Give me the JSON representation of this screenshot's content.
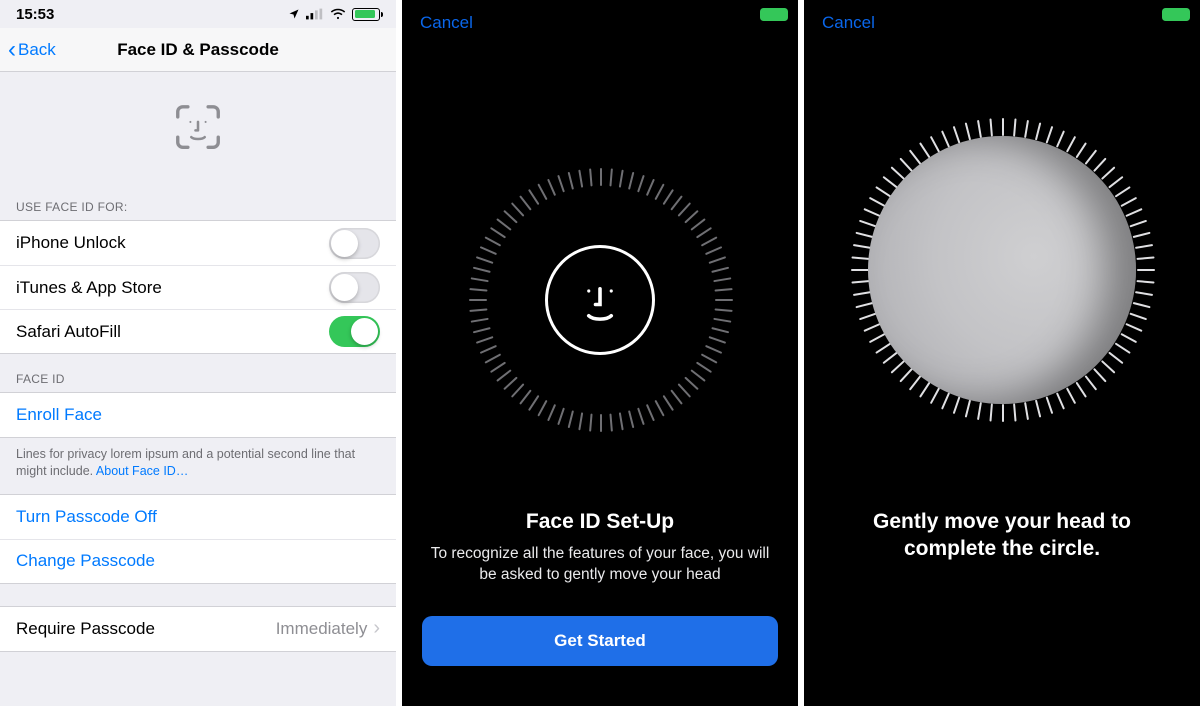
{
  "screen1": {
    "status_time": "15:53",
    "nav": {
      "back": "Back",
      "title": "Face ID & Passcode"
    },
    "section_use_header": "USE FACE ID FOR:",
    "toggles": [
      {
        "label": "iPhone Unlock",
        "on": false
      },
      {
        "label": "iTunes & App Store",
        "on": false
      },
      {
        "label": "Safari AutoFill",
        "on": true
      }
    ],
    "section_faceid_header": "FACE ID",
    "enroll_label": "Enroll Face",
    "privacy_note": "Lines for privacy lorem ipsum and a potential second line that might include. ",
    "privacy_link": "About Face ID…",
    "turn_off_label": "Turn Passcode Off",
    "change_label": "Change Passcode",
    "require_label": "Require Passcode",
    "require_value": "Immediately"
  },
  "screen2": {
    "cancel": "Cancel",
    "headline": "Face ID Set-Up",
    "sub": "To recognize all the features of your face, you will be asked to gently move your head",
    "cta": "Get Started"
  },
  "screen3": {
    "cancel": "Cancel",
    "headline": "Gently move your head to complete the circle."
  },
  "colors": {
    "ios_blue": "#007aff",
    "cta_blue": "#1f6fe8",
    "green": "#34c759"
  }
}
